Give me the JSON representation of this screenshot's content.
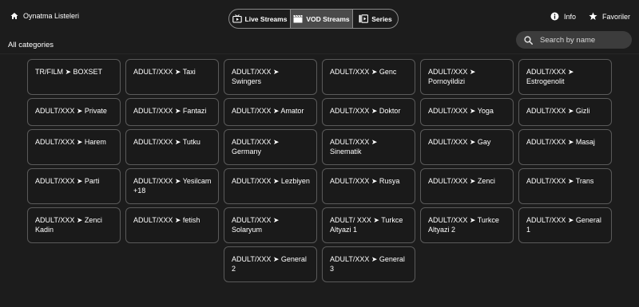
{
  "header": {
    "playlists_label": "Oynatma Listeleri",
    "tabs": [
      {
        "label": "Live Streams",
        "icon": "live-tv-icon"
      },
      {
        "label": "VOD Streams",
        "icon": "movie-clapper-icon",
        "active": true
      },
      {
        "label": "Series",
        "icon": "series-icon"
      }
    ],
    "info_label": "Info",
    "favorites_label": "Favoriler"
  },
  "subheader": {
    "all_categories": "All categories",
    "search_placeholder": "Search by name"
  },
  "colors": {
    "background": "#1c1c1c",
    "card_border": "#5a5a5a",
    "active_tab": "#4a4a4a",
    "search_bg": "#3c3c3c"
  },
  "categories": [
    [
      "TR/FILM ➤ BOXSET",
      "ADULT/XXX ➤ Taxi",
      "ADULT/XXX ➤ Swingers",
      "ADULT/XXX ➤ Genc",
      "ADULT/XXX ➤ Pornoyildizi",
      "ADULT/XXX ➤ Estrogenolit"
    ],
    [
      "ADULT/XXX ➤ Private",
      "ADULT/XXX ➤ Fantazi",
      "ADULT/XXX ➤ Amator",
      "ADULT/XXX ➤ Doktor",
      "ADULT/XXX ➤ Yoga",
      "ADULT/XXX ➤ Gizli"
    ],
    [
      "ADULT/XXX ➤ Harem",
      "ADULT/XXX ➤ Tutku",
      "ADULT/XXX ➤ Germany",
      "ADULT/XXX ➤ Sinematik",
      "ADULT/XXX ➤ Gay",
      "ADULT/XXX ➤ Masaj"
    ],
    [
      "ADULT/XXX ➤ Parti",
      "ADULT/XXX ➤ Yesilcam +18",
      "ADULT/XXX ➤ Lezbiyen",
      "ADULT/XXX ➤ Rusya",
      "ADULT/XXX ➤ Zenci",
      "ADULT/XXX ➤ Trans"
    ],
    [
      "ADULT/XXX ➤ Zenci Kadin",
      "ADULT/XXX ➤ fetish",
      "ADULT/XXX ➤ Solaryum",
      "ADULT/ XXX ➤ Turkce Altyazi 1",
      "ADULT/XXX ➤ Turkce Altyazi 2",
      "ADULT/XXX ➤ General 1"
    ],
    [
      "ADULT/XXX ➤ General 2",
      "ADULT/XXX ➤ General 3"
    ]
  ]
}
